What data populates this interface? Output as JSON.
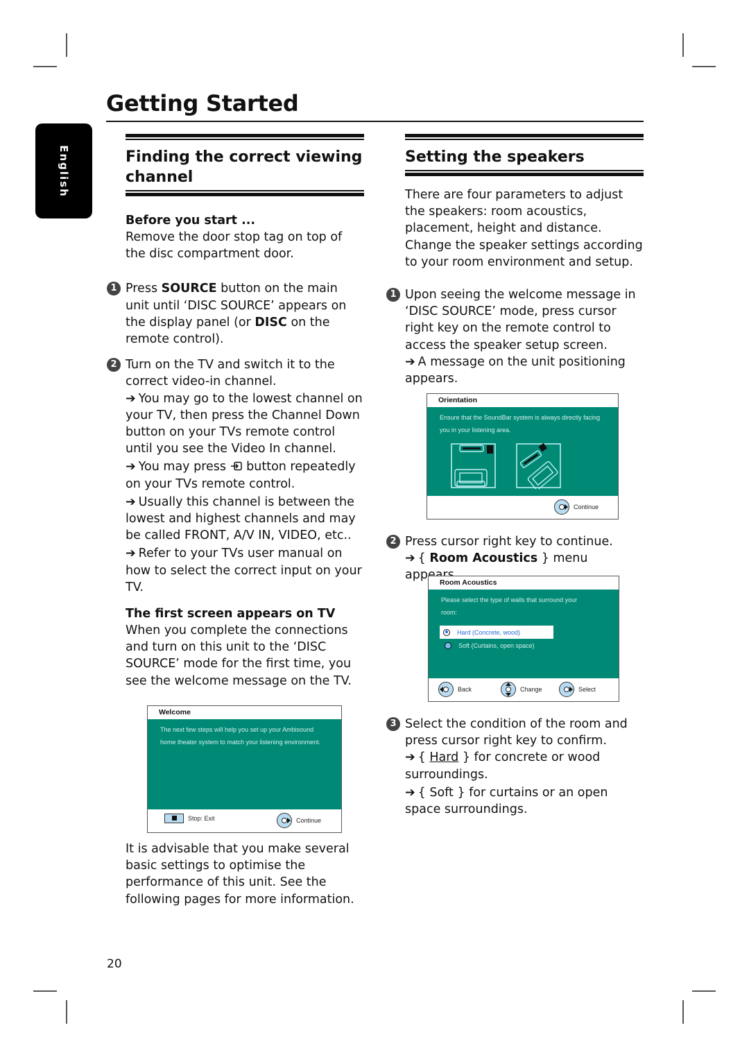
{
  "page": {
    "title": "Getting Started",
    "language_tab": "English",
    "page_number": "20"
  },
  "left": {
    "section_title": "Finding the correct viewing channel",
    "before_head": "Before you start ...",
    "before_text": "Remove the door stop tag on top of the disc compartment door.",
    "step1": {
      "num": "1",
      "p1": "Press ",
      "b1": "SOURCE",
      "p2": " button on the main unit until ‘DISC SOURCE’ appears on the display panel (or ",
      "b2": "DISC",
      "p3": " on the remote control)."
    },
    "step2": {
      "num": "2",
      "text": "Turn on the TV and switch it to the correct video-in channel.",
      "bullets": [
        "You may go to the lowest channel on your TV, then press the Channel Down button on your TVs remote control until you see the Video In channel.",
        "Usually this channel is between the lowest and highest channels and may be called FRONT, A/V IN, VIDEO, etc..",
        "Refer to your TVs user manual on how to select the correct input on your TV."
      ],
      "press_a": "You may press ",
      "press_b": " button repeatedly on your TVs remote control."
    },
    "first_screen_head": "The first screen appears on TV",
    "first_screen_text": "When you complete the connections and turn on this unit to the ‘DISC SOURCE’ mode for the first time, you see the welcome message on the TV.",
    "welcome_screen": {
      "title": "Welcome",
      "body": "The next few steps will help you set up your Ambisound home theater system to match your listening environment.",
      "stop_label": "Stop: Exit",
      "continue_label": "Continue"
    },
    "closing": "It is advisable that you make several basic settings to optimise the performance of this unit.  See the following pages for more information."
  },
  "right": {
    "section_title": "Setting the speakers",
    "intro": "There are four parameters to adjust the speakers: room acoustics, placement, height and distance.  Change the speaker settings according to your room environment and setup.",
    "step1": {
      "num": "1",
      "text": "Upon seeing the welcome message in ‘DISC SOURCE’ mode, press cursor right key on the remote control to access the speaker setup screen.",
      "result": "A message on the unit positioning appears."
    },
    "orientation_screen": {
      "title": "Orientation",
      "body": "Ensure that the SoundBar system is always directly facing you in your listening area.",
      "continue_label": "Continue"
    },
    "step2": {
      "num": "2",
      "text": "Press cursor right key to continue.",
      "result_a": "{ ",
      "result_b": "Room Acoustics",
      "result_c": " } menu appears."
    },
    "acoustics_screen": {
      "title": "Room Acoustics",
      "body": "Please select the type of walls that surround your room:",
      "options": [
        "Hard (Concrete, wood)",
        "Soft (Curtains, open space)"
      ],
      "selected": "Hard (Concrete, wood)",
      "back_label": "Back",
      "change_label": "Change",
      "select_label": "Select"
    },
    "step3": {
      "num": "3",
      "text": "Select the condition of the room and press cursor right key to confirm.",
      "hard_a": "{ ",
      "hard_b": "Hard",
      "hard_c": " } for concrete or wood surroundings.",
      "soft": "{ Soft } for curtains or an open space surroundings."
    },
    "arrow_glyph": "➔"
  },
  "colors": {
    "screen_teal": "#008a76",
    "dpad_blue": "#b9dcf2",
    "selected_blue": "#2a6bd6"
  }
}
